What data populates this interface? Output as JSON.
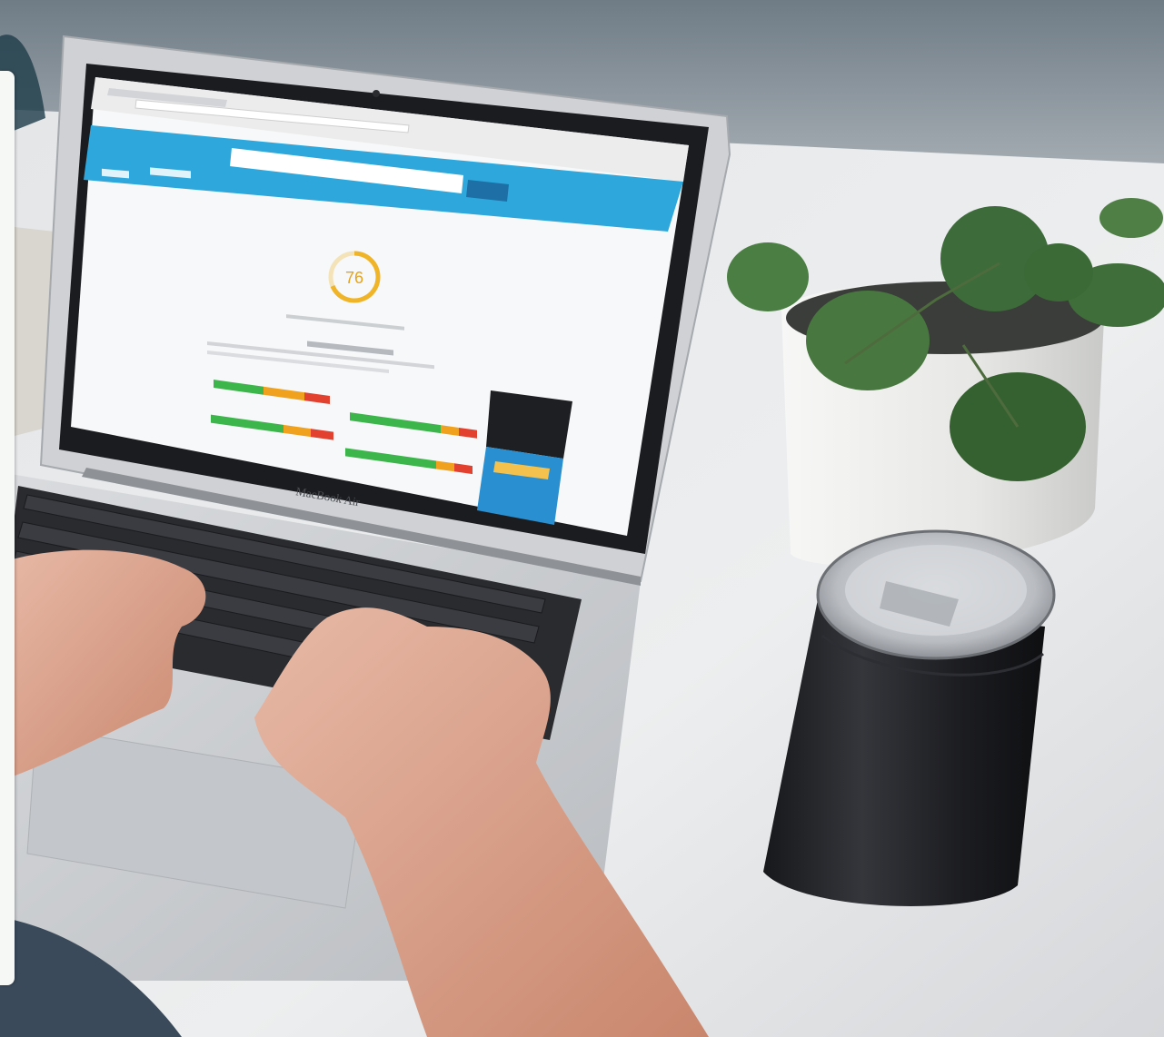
{
  "laptop": {
    "brand_label": "MacBook Air"
  },
  "screen": {
    "gauge_value": 76,
    "accent": "#2ea8dc",
    "gauge_color": "#f0b429",
    "metric_colors": {
      "good": "#3cb54a",
      "average": "#f0a21e",
      "poor": "#e2412f"
    }
  },
  "icons": [
    "browser-back-icon",
    "browser-reload-icon"
  ]
}
